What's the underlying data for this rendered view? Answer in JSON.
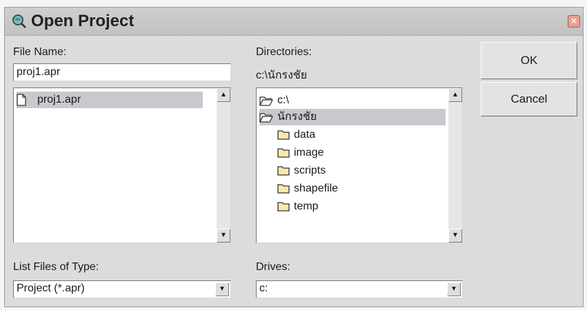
{
  "title": "Open Project",
  "file_name": {
    "label": "File Name:",
    "value": "proj1.apr",
    "list": [
      "proj1.apr"
    ]
  },
  "directories": {
    "label": "Directories:",
    "current_path": "c:\\นักรงชัย",
    "items": [
      {
        "label": "c:\\",
        "icon": "open-folder-icon",
        "selected": false
      },
      {
        "label": "นักรงชัย",
        "icon": "open-folder-icon",
        "selected": true
      },
      {
        "label": "data",
        "icon": "folder-icon",
        "selected": false
      },
      {
        "label": "image",
        "icon": "folder-icon",
        "selected": false
      },
      {
        "label": "scripts",
        "icon": "folder-icon",
        "selected": false
      },
      {
        "label": "shapefile",
        "icon": "folder-icon",
        "selected": false
      },
      {
        "label": "temp",
        "icon": "folder-icon",
        "selected": false
      }
    ]
  },
  "file_type": {
    "label": "List Files of Type:",
    "value": "Project (*.apr)"
  },
  "drives": {
    "label": "Drives:",
    "value": "c:"
  },
  "buttons": {
    "ok": "OK",
    "cancel": "Cancel"
  }
}
